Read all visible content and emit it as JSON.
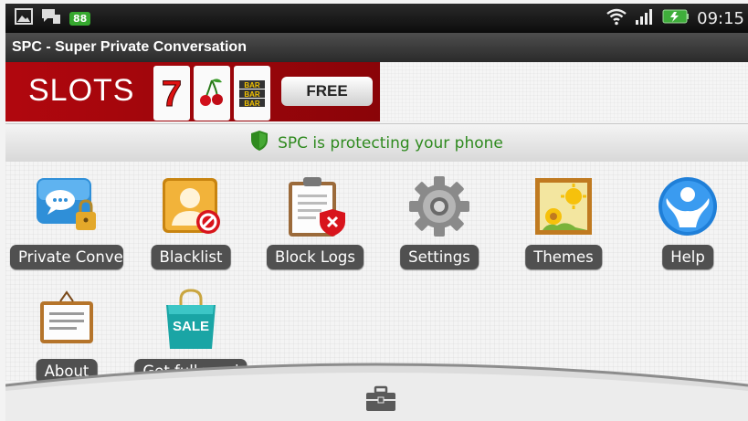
{
  "status_bar": {
    "left_icons": [
      "gallery-icon",
      "chat-notification-icon",
      "battery-88-icon"
    ],
    "battery_badge": "88",
    "right_icons": [
      "wifi-icon",
      "signal-icon",
      "battery-charging-icon"
    ],
    "time": "09:15"
  },
  "app": {
    "title": "SPC - Super Private Conversation"
  },
  "ad_banner": {
    "text": "SLOTS",
    "reels": [
      "7",
      "cherry",
      "BAR"
    ],
    "button_label": "FREE",
    "colors": {
      "background": "#a5060c"
    }
  },
  "protect_bar": {
    "text": "SPC is protecting your phone",
    "icon": "shield-icon",
    "color": "#2f8a1f"
  },
  "grid_items": [
    {
      "label": "Private Conve",
      "icon": "private-conversation-icon"
    },
    {
      "label": "Blacklist",
      "icon": "blacklist-icon"
    },
    {
      "label": "Block Logs",
      "icon": "block-logs-icon"
    },
    {
      "label": "Settings",
      "icon": "gear-icon"
    },
    {
      "label": "Themes",
      "icon": "themes-icon"
    },
    {
      "label": "Help",
      "icon": "help-icon"
    },
    {
      "label": "About",
      "icon": "about-icon"
    },
    {
      "label": "Get full versi",
      "icon": "sale-bag-icon"
    }
  ],
  "dock": {
    "icon": "toolbox-icon"
  }
}
